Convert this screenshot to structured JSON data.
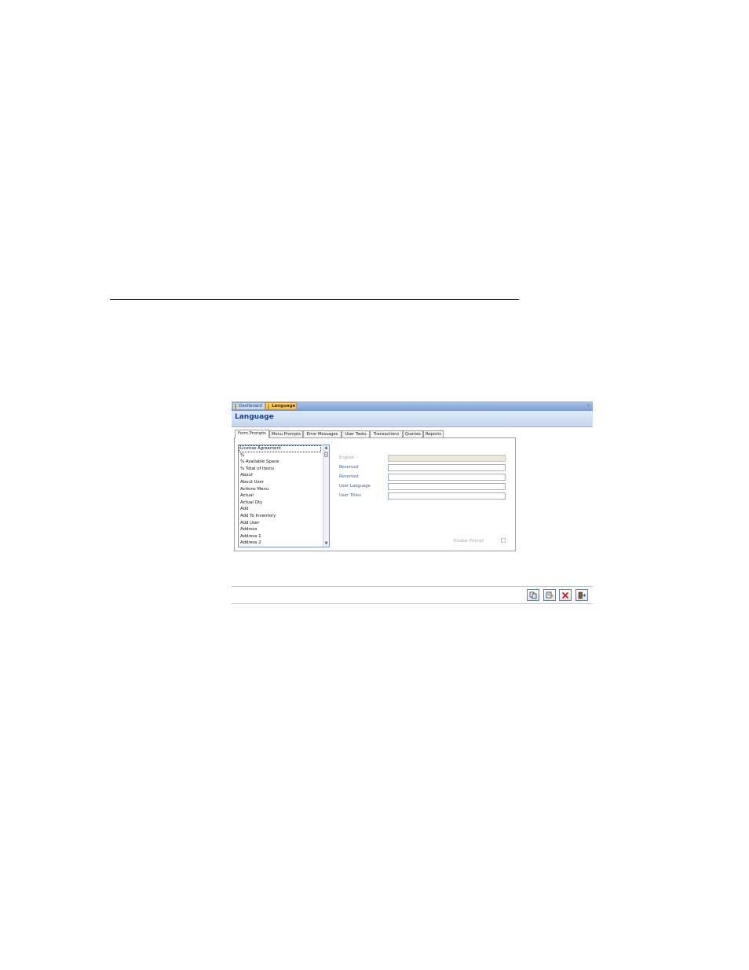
{
  "window": {
    "tabs": [
      {
        "label": "Dashboard",
        "active": false
      },
      {
        "label": "Language",
        "active": true
      }
    ],
    "close_glyph": "×"
  },
  "header": {
    "title": "Language"
  },
  "prompt_tabs": [
    "Form Prompts",
    "Menu Prompts",
    "Error Messages",
    "User Tasks",
    "Transactions",
    "Queries",
    "Reports"
  ],
  "list": {
    "items": [
      "License Agreement",
      "%",
      "% Available Space",
      "% Total of Items",
      "About",
      "About User",
      "Actions Menu",
      "Actual",
      "Actual Qty",
      "Add",
      "Add To Inventory",
      "Add User",
      "Address",
      "Address 1",
      "Address 2"
    ],
    "scroll_up_glyph": "▲",
    "scroll_down_glyph": "▼"
  },
  "fields": [
    {
      "label": "English",
      "value": "",
      "enabled": false
    },
    {
      "label": "Reserved",
      "value": "",
      "enabled": true
    },
    {
      "label": "Reserved",
      "value": "",
      "enabled": true
    },
    {
      "label": "User Language",
      "value": "",
      "enabled": true
    },
    {
      "label": "User Titles",
      "value": "",
      "enabled": true
    }
  ],
  "enable_prompt": {
    "label": "Enable Prompt",
    "checked": false
  },
  "colors": {
    "header_title": "#15428b",
    "label_blue": "#2e5fa8",
    "active_tab": "#f7b94a",
    "delete_red": "#cc1111"
  },
  "footer_buttons": [
    {
      "icon": "copy-icon"
    },
    {
      "icon": "edit-icon"
    },
    {
      "icon": "delete-icon"
    },
    {
      "icon": "exit-icon"
    }
  ]
}
